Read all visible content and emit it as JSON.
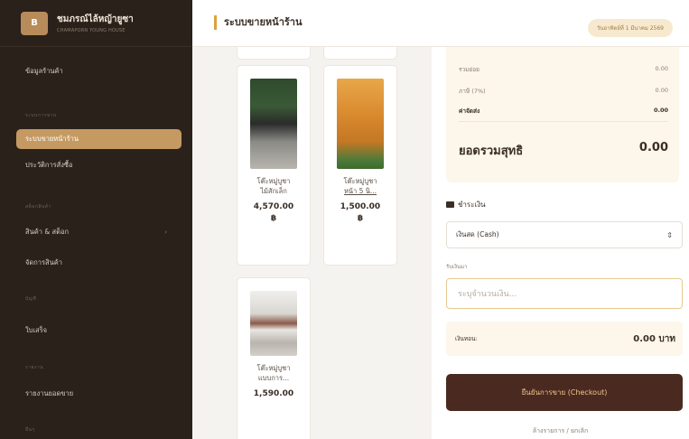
{
  "brand": {
    "logo_text": "B",
    "name": "ชมภรณ์ไล้หญ้ายูซา",
    "sub": "CHAMAPORN YOUNG HOUSE"
  },
  "sidebar": {
    "top_item": "ข้อมูลร้านค้า",
    "section1": "ระบบการขาย",
    "active_item": "ระบบขายหน้าร้าน",
    "item2": "ประวัติการสั่งซื้อ",
    "section2": "สต็อกสินค้า",
    "item3": "สินค้า & สต็อก",
    "item4": "จัดการสินค้า",
    "section3": "บัญชี",
    "item5": "ใบเสร็จ",
    "section4": "รายงาน",
    "item6": "รายงานยอดขาย",
    "section5": "อื่นๆ"
  },
  "header": {
    "title": "ระบบขายหน้าร้าน",
    "date": "วันอาทิตย์ที่ 1 มีนาคม 2569"
  },
  "products": [
    {
      "name_line1": "โต๊ะหมู่บูชา",
      "name_line2": "ไม้สักเล็ก",
      "price_line1": "4,570.00",
      "price_line2": "฿"
    },
    {
      "name_line1": "โต๊ะหมู่บูชา",
      "name_line2": "หน้า 5 นิ...",
      "price_line1": "1,500.00",
      "price_line2": "฿"
    },
    {
      "name_line1": "โต๊ะหมู่บูชา",
      "name_line2": "แบบการ...",
      "price_line1": "1,590.00",
      "price_line2": ""
    }
  ],
  "summary": {
    "subtotal_label": "รวมย่อย",
    "subtotal_value": "0.00",
    "vat_label": "ภาษี (7%)",
    "vat_value": "0.00",
    "shipping_label": "ค่าจัดส่ง",
    "shipping_value": "0.00",
    "net_label": "ยอดรวมสุทธิ",
    "net_value": "0.00"
  },
  "payment": {
    "title": "ชำระเงิน",
    "method": "เงินสด (Cash)",
    "received_label": "รับเงินมา",
    "received_placeholder": "ระบุจำนวนเงิน...",
    "change_label": "เงินทอน:",
    "change_value": "0.00 บาท",
    "checkout_label": "ยืนยันการขาย (Checkout)",
    "cancel_label": "ล้างรายการ / ยกเลิก"
  }
}
